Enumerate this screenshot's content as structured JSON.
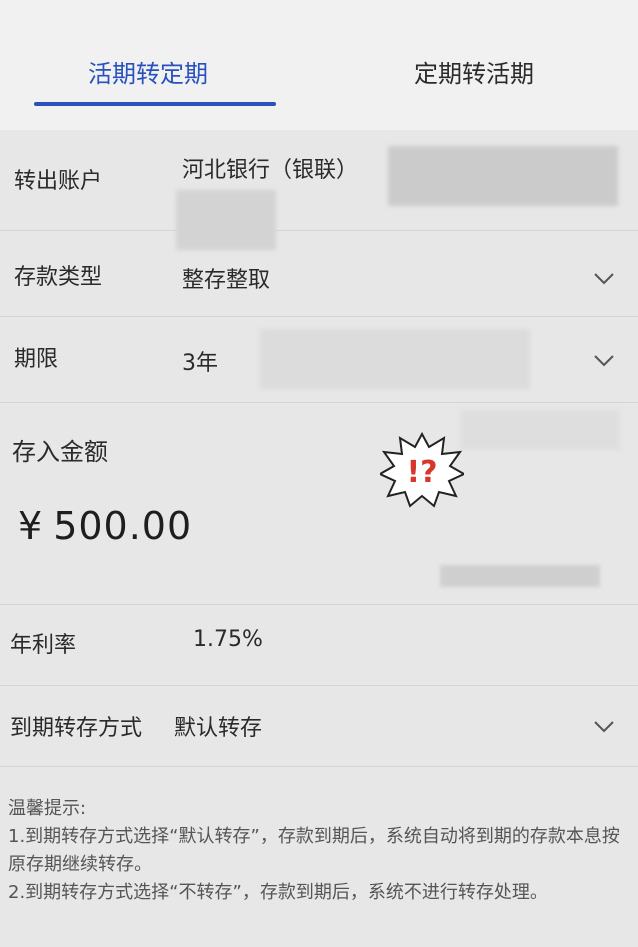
{
  "tabs": {
    "active_label": "活期转定期",
    "inactive_label": "定期转活期"
  },
  "form": {
    "from_account_label": "转出账户",
    "from_account_value": "河北银行（银联）",
    "deposit_type_label": "存款类型",
    "deposit_type_value": "整存整取",
    "term_label": "期限",
    "term_value": "3年",
    "amount_label": "存入金额",
    "currency_symbol": "¥",
    "amount_value": "500.00",
    "rate_label": "年利率",
    "rate_value": "1.75%",
    "renewal_label": "到期转存方式",
    "renewal_value": "默认转存"
  },
  "notice": {
    "title": "温馨提示:",
    "line1": "1.到期转存方式选择“默认转存”，存款到期后，系统自动将到期的存款本息按原存期继续转存。",
    "line2": "2.到期转存方式选择“不转存”，存款到期后，系统不进行转存处理。"
  },
  "icons": {
    "chevron": "chevron-down-icon",
    "sticker": "exclamation-question-sticker"
  },
  "colors": {
    "accent": "#2a52be",
    "sticker_red": "#d9362b"
  }
}
